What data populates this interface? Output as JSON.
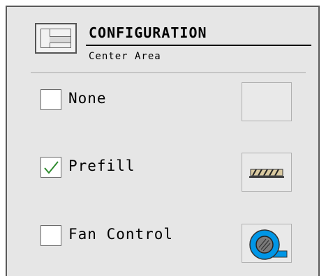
{
  "header": {
    "title": "CONFIGURATION",
    "subtitle": "Center Area",
    "icon": "layout-icon"
  },
  "options": [
    {
      "label": "None",
      "checked": false,
      "icon": "empty-icon"
    },
    {
      "label": "Prefill",
      "checked": true,
      "icon": "prefill-icon"
    },
    {
      "label": "Fan Control",
      "checked": false,
      "icon": "fan-icon"
    }
  ],
  "colors": {
    "panel_bg": "#e6e6e6",
    "check_green": "#2e8b2e",
    "fan_blue": "#0096e6"
  }
}
